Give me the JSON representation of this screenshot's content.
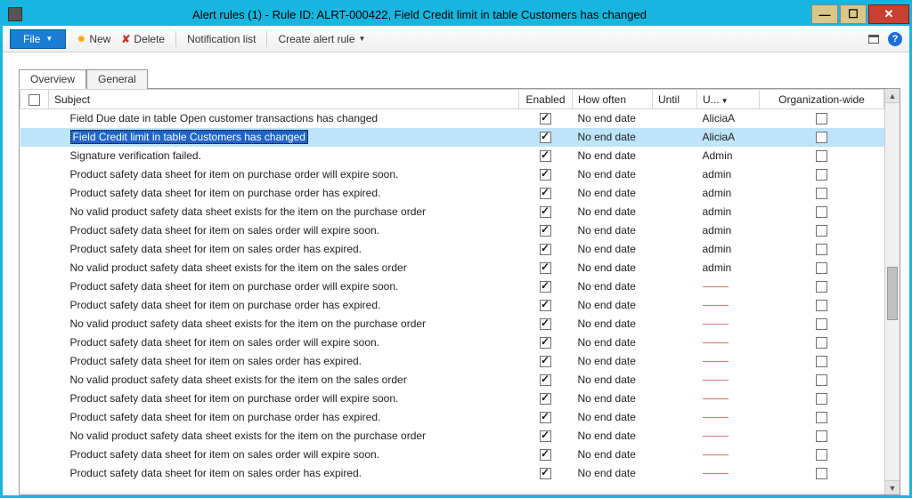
{
  "window": {
    "title": "Alert rules (1) - Rule ID: ALRT-000422, Field Credit limit in table Customers has changed"
  },
  "toolbar": {
    "file": "File",
    "new": "New",
    "delete": "Delete",
    "notification_list": "Notification list",
    "create_rule": "Create alert rule"
  },
  "tabs": {
    "overview": "Overview",
    "general": "General"
  },
  "columns": {
    "subject": "Subject",
    "enabled": "Enabled",
    "how_often": "How often",
    "until": "Until",
    "user": "U...",
    "org": "Organization-wide"
  },
  "selected_index": 1,
  "rows": [
    {
      "subject": "Field Due date in table Open customer transactions has changed",
      "enabled": true,
      "how": "No end date",
      "until": "",
      "user": "AliciaA",
      "org": false
    },
    {
      "subject": "Field Credit limit in table Customers has changed",
      "enabled": true,
      "how": "No end date",
      "until": "",
      "user": "AliciaA",
      "org": false
    },
    {
      "subject": "Signature verification failed.",
      "enabled": true,
      "how": "No end date",
      "until": "",
      "user": "Admin",
      "org": false
    },
    {
      "subject": "Product safety data sheet for item on purchase order will expire soon.",
      "enabled": true,
      "how": "No end date",
      "until": "",
      "user": "admin",
      "org": false
    },
    {
      "subject": "Product safety data sheet for item on purchase order has expired.",
      "enabled": true,
      "how": "No end date",
      "until": "",
      "user": "admin",
      "org": false
    },
    {
      "subject": "No valid product safety data sheet exists for the item on the purchase order",
      "enabled": true,
      "how": "No end date",
      "until": "",
      "user": "admin",
      "org": false
    },
    {
      "subject": "Product safety data sheet for item on sales order will expire soon.",
      "enabled": true,
      "how": "No end date",
      "until": "",
      "user": "admin",
      "org": false
    },
    {
      "subject": "Product safety data sheet for item on sales order has expired.",
      "enabled": true,
      "how": "No end date",
      "until": "",
      "user": "admin",
      "org": false
    },
    {
      "subject": "No valid product safety data sheet exists for the item on the sales order",
      "enabled": true,
      "how": "No end date",
      "until": "",
      "user": "admin",
      "org": false
    },
    {
      "subject": "Product safety data sheet for item on purchase order will expire soon.",
      "enabled": true,
      "how": "No end date",
      "until": "",
      "user": "~",
      "org": false
    },
    {
      "subject": "Product safety data sheet for item on purchase order has expired.",
      "enabled": true,
      "how": "No end date",
      "until": "",
      "user": "~",
      "org": false
    },
    {
      "subject": "No valid product safety data sheet exists for the item on the purchase order",
      "enabled": true,
      "how": "No end date",
      "until": "",
      "user": "~",
      "org": false
    },
    {
      "subject": "Product safety data sheet for item on sales order will expire soon.",
      "enabled": true,
      "how": "No end date",
      "until": "",
      "user": "~",
      "org": false
    },
    {
      "subject": "Product safety data sheet for item on sales order has expired.",
      "enabled": true,
      "how": "No end date",
      "until": "",
      "user": "~",
      "org": false
    },
    {
      "subject": "No valid product safety data sheet exists for the item on the sales order",
      "enabled": true,
      "how": "No end date",
      "until": "",
      "user": "~",
      "org": false
    },
    {
      "subject": "Product safety data sheet for item on purchase order will expire soon.",
      "enabled": true,
      "how": "No end date",
      "until": "",
      "user": "~",
      "org": false
    },
    {
      "subject": "Product safety data sheet for item on purchase order has expired.",
      "enabled": true,
      "how": "No end date",
      "until": "",
      "user": "~",
      "org": false
    },
    {
      "subject": "No valid product safety data sheet exists for the item on the purchase order",
      "enabled": true,
      "how": "No end date",
      "until": "",
      "user": "~",
      "org": false
    },
    {
      "subject": "Product safety data sheet for item on sales order will expire soon.",
      "enabled": true,
      "how": "No end date",
      "until": "",
      "user": "~",
      "org": false
    },
    {
      "subject": "Product safety data sheet for item on sales order has expired.",
      "enabled": true,
      "how": "No end date",
      "until": "",
      "user": "~",
      "org": false
    }
  ]
}
